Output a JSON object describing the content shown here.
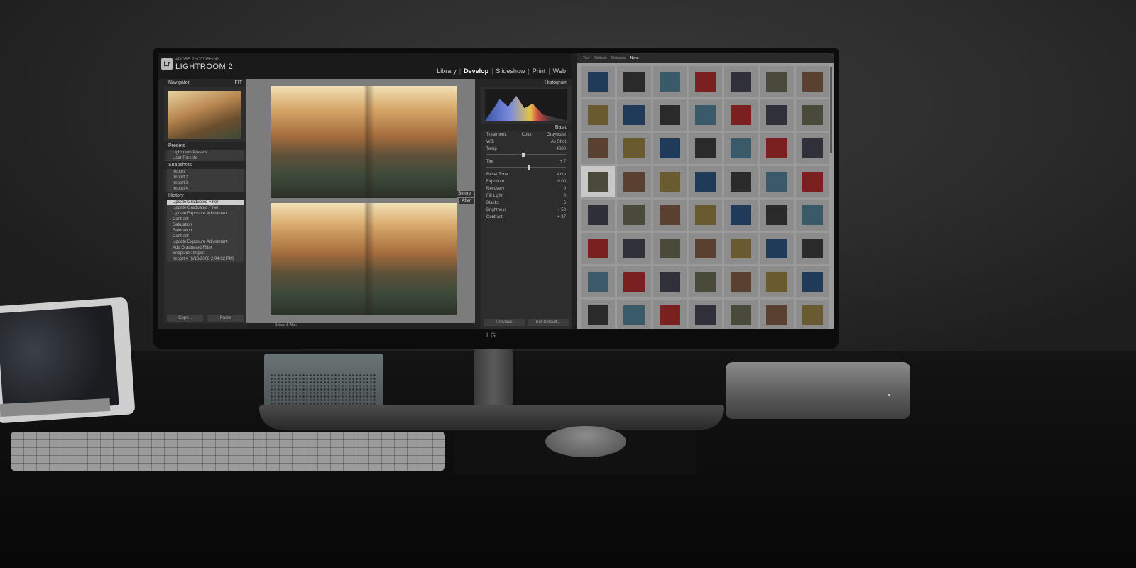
{
  "monitor": {
    "brand": "LG"
  },
  "app": {
    "badge": "Lr",
    "brand_small": "ADOBE PHOTOSHOP",
    "brand": "LIGHTROOM 2",
    "modules": [
      {
        "label": "Library",
        "active": false
      },
      {
        "label": "Develop",
        "active": true
      },
      {
        "label": "Slideshow",
        "active": false
      },
      {
        "label": "Print",
        "active": false
      },
      {
        "label": "Web",
        "active": false
      }
    ]
  },
  "left_panel": {
    "navigator": {
      "title": "Navigator",
      "zoom": "FIT"
    },
    "presets": {
      "title": "Presets",
      "items": [
        "Lightroom Presets",
        "User Presets"
      ]
    },
    "snapshots": {
      "title": "Snapshots",
      "items": [
        "Import",
        "Import 2",
        "Import 3",
        "Import 4"
      ]
    },
    "history": {
      "title": "History",
      "items": [
        "Update Graduated Filter",
        "Update Graduated Filter",
        "Update Exposure Adjustment",
        "Contrast",
        "Saturation",
        "Saturation",
        "Contrast",
        "Update Exposure Adjustment",
        "Add Graduated Filter",
        "Snapshot: Import",
        "Import 4 (6/10/2008 2:04:02 PM)"
      ],
      "selected_index": 0
    },
    "copy_label": "Copy...",
    "paste_label": "Paste"
  },
  "center": {
    "before_label": "Before",
    "after_label": "After",
    "toolbar_label": "Before & After:"
  },
  "right_panel": {
    "histogram_title": "Histogram",
    "basic_title": "Basic",
    "treatment_label": "Treatment:",
    "color_label": "Color",
    "grayscale_label": "Grayscale",
    "wb_label": "WB:",
    "wb_value": "As Shot",
    "rows": [
      {
        "label": "Temp",
        "value": "4800"
      },
      {
        "label": "Tint",
        "value": "+ 7"
      },
      {
        "label": "Exposure",
        "value": "0.00"
      },
      {
        "label": "Recovery",
        "value": "0"
      },
      {
        "label": "Fill Light",
        "value": "0"
      },
      {
        "label": "Blacks",
        "value": "5"
      },
      {
        "label": "Brightness",
        "value": "+ 50"
      },
      {
        "label": "Contrast",
        "value": "+ 37"
      }
    ],
    "tone_label": "Reset Tone",
    "auto_label": "Auto",
    "previous_label": "Previous",
    "reset_label": "Set Default..."
  },
  "grid": {
    "tabs": [
      "Text",
      "Attribute",
      "Metadata",
      "None"
    ],
    "active_tab": "None",
    "selected_index": 21,
    "cell_count": 56
  }
}
